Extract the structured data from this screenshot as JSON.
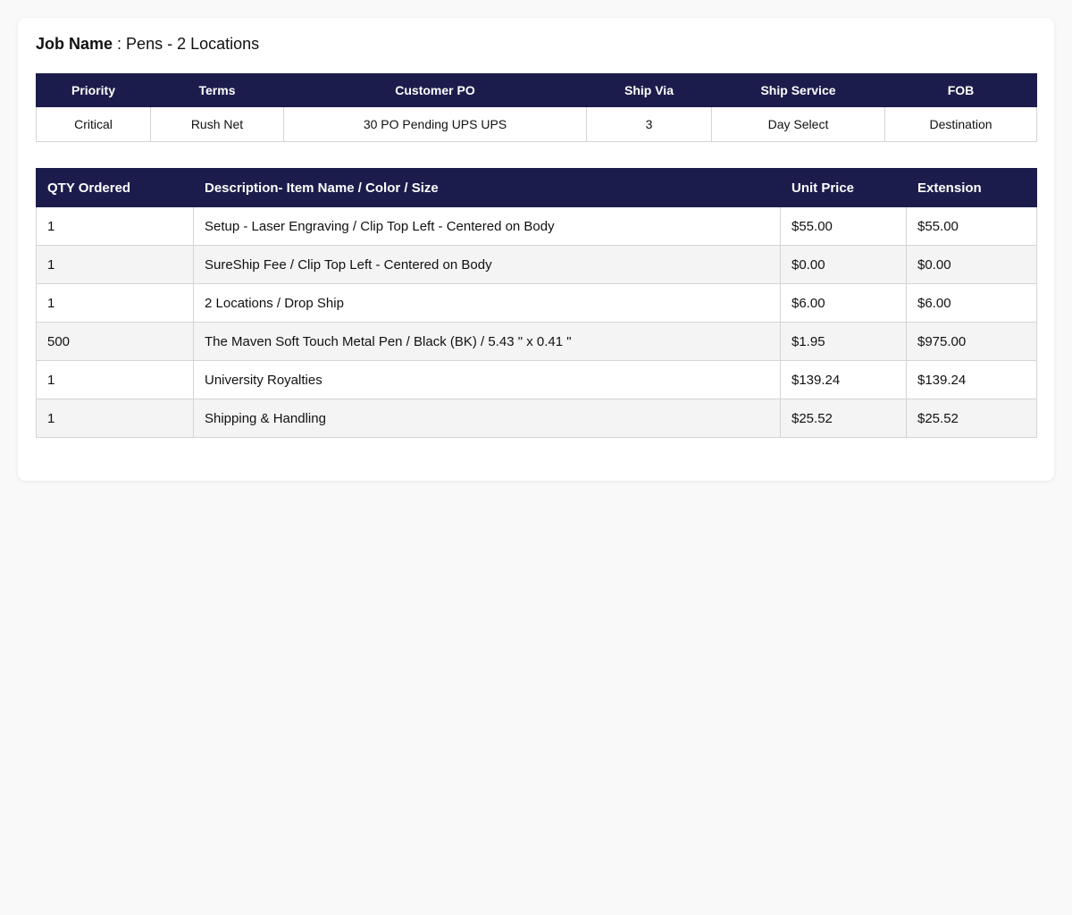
{
  "job": {
    "label": "Job Name",
    "separator": " : ",
    "value": "Pens - 2 Locations"
  },
  "meta": {
    "headers": [
      "Priority",
      "Terms",
      "Customer PO",
      "Ship Via",
      "Ship Service",
      "FOB"
    ],
    "values": [
      "Critical",
      "Rush Net",
      "30 PO Pending UPS UPS",
      "3",
      "Day Select",
      "Destination"
    ]
  },
  "items": {
    "headers": [
      "QTY Ordered",
      "Description- Item Name / Color / Size",
      "Unit Price",
      "Extension"
    ],
    "rows": [
      [
        "1",
        "Setup - Laser Engraving / Clip Top Left - Centered on Body",
        "$55.00",
        "$55.00"
      ],
      [
        "1",
        "SureShip Fee / Clip Top Left - Centered on Body",
        "$0.00",
        "$0.00"
      ],
      [
        "1",
        "2 Locations / Drop Ship",
        "$6.00",
        "$6.00"
      ],
      [
        "500",
        "The Maven Soft Touch Metal Pen / Black (BK) / 5.43 \" x 0.41 \"",
        "$1.95",
        "$975.00"
      ],
      [
        "1",
        "University Royalties",
        "$139.24",
        "$139.24"
      ],
      [
        "1",
        "Shipping & Handling",
        "$25.52",
        "$25.52"
      ]
    ]
  },
  "colors": {
    "header_bg": "#1c1c4c",
    "alt_row_bg": "#f4f4f4"
  }
}
